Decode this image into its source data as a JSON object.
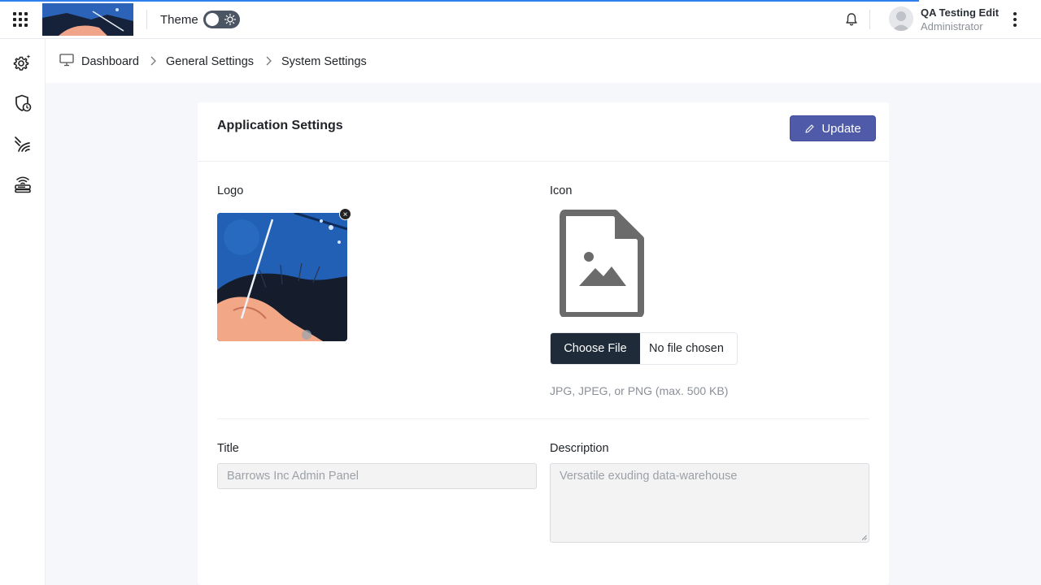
{
  "topbar": {
    "theme_label": "Theme",
    "user": {
      "name": "QA Testing Edit",
      "role": "Administrator"
    }
  },
  "sidebar": {
    "items": [
      {
        "icon": "settings-gear-icon"
      },
      {
        "icon": "shield-clock-icon"
      },
      {
        "icon": "signal-waves-icon"
      },
      {
        "icon": "router-icon"
      }
    ]
  },
  "breadcrumb": {
    "items": [
      "Dashboard",
      "General Settings",
      "System Settings"
    ]
  },
  "card": {
    "title": "Application Settings",
    "update_label": "Update",
    "logo_label": "Logo",
    "icon_label": "Icon",
    "choose_file_label": "Choose File",
    "no_file_text": "No file chosen",
    "file_hint": "JPG, JPEG, or PNG (max. 500 KB)",
    "title_label": "Title",
    "title_placeholder": "Barrows Inc Admin Panel",
    "description_label": "Description",
    "description_placeholder": "Versatile exuding data-warehouse"
  },
  "colors": {
    "accent": "#4f5aa8",
    "file_button": "#1f2b38",
    "progress": "#2f80ed"
  }
}
